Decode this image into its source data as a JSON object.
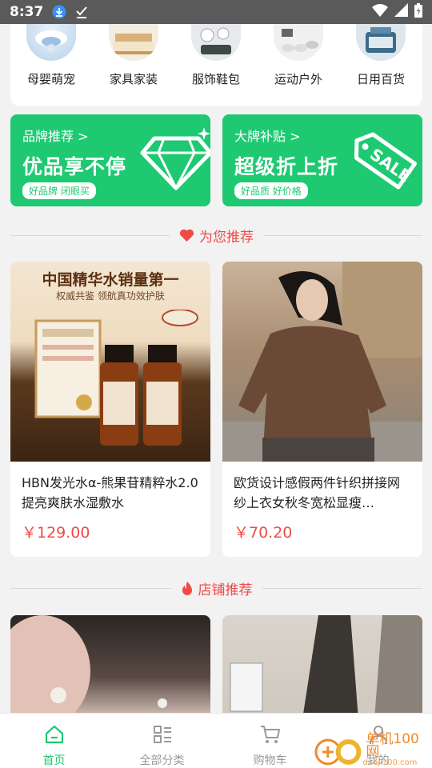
{
  "status_bar": {
    "time": "8:37"
  },
  "categories": [
    {
      "label": "母婴萌宠"
    },
    {
      "label": "家具家装"
    },
    {
      "label": "服饰鞋包"
    },
    {
      "label": "运动户外"
    },
    {
      "label": "日用百货"
    }
  ],
  "promos": [
    {
      "title": "品牌推荐 >",
      "headline": "优品享不停",
      "tag": "好品牌 闭眼买"
    },
    {
      "title": "大牌补贴 >",
      "headline": "超级折上折",
      "tag": "好品质 好价格",
      "sale_text": "SALE"
    }
  ],
  "sections": {
    "recommend": "为您推荐",
    "shops": "店铺推荐"
  },
  "products": [
    {
      "banner_title": "中国精华水销量第一",
      "banner_sub": "权威共鉴 领航真功效护肤",
      "name": "HBN发光水α-熊果苷精粹水2.0提亮爽肤水湿敷水",
      "price": "￥129.00"
    },
    {
      "name": "欧货设计感假两件针织拼接网纱上衣女秋冬宽松显瘦…",
      "price": "￥70.20"
    }
  ],
  "tabs": [
    {
      "label": "首页"
    },
    {
      "label": "全部分类"
    },
    {
      "label": "购物车"
    },
    {
      "label": "我的"
    }
  ],
  "watermark": {
    "text": "单机100网",
    "sub": "danji100.com"
  },
  "colors": {
    "accent": "#1ec972",
    "price": "#ef4b46",
    "status_bar": "#5a5a5a"
  }
}
